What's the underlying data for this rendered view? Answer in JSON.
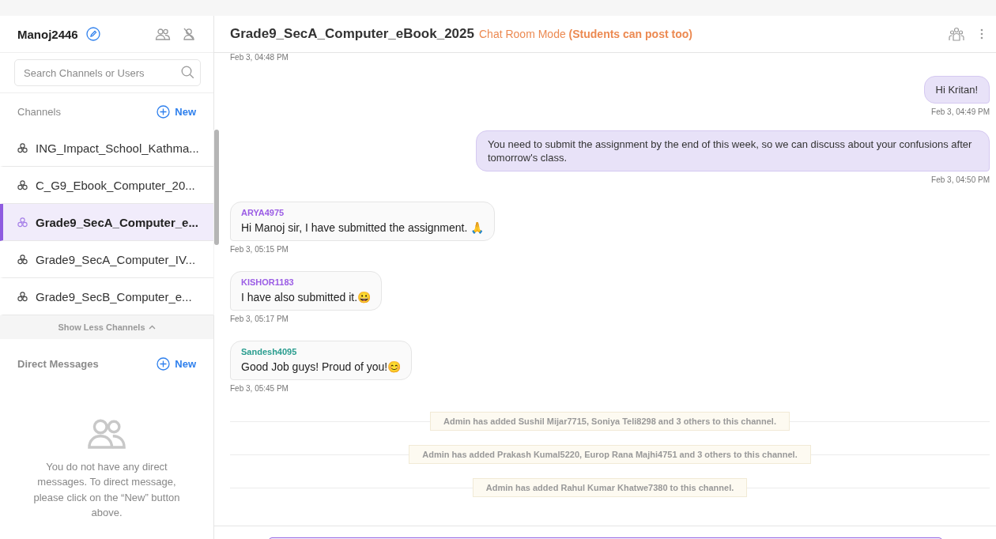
{
  "sidebar": {
    "username": "Manoj2446",
    "search": {
      "placeholder": "Search Channels or Users"
    },
    "channels_header": {
      "title": "Channels",
      "new_label": "New"
    },
    "channels": [
      {
        "name": "ING_Impact_School_Kathma...",
        "selected": false
      },
      {
        "name": "C_G9_Ebook_Computer_20...",
        "selected": false
      },
      {
        "name": "Grade9_SecA_Computer_e...",
        "selected": true
      },
      {
        "name": "Grade9_SecA_Computer_IV...",
        "selected": false
      },
      {
        "name": "Grade9_SecB_Computer_e...",
        "selected": false
      }
    ],
    "show_less": "Show Less Channels",
    "dm_header": {
      "title": "Direct Messages",
      "new_label": "New"
    },
    "dm_empty": "You do not have any direct messages. To direct message, please click on the “New” button above."
  },
  "chat": {
    "title": "Grade9_SecA_Computer_eBook_2025",
    "mode": "Chat Room Mode",
    "mode_note": "(Students can post too)",
    "messages": [
      {
        "kind": "timestamp",
        "time": "Feb 3, 04:48 PM"
      },
      {
        "kind": "outgoing",
        "text": "Hi Kritan!",
        "time": "Feb 3, 04:49 PM"
      },
      {
        "kind": "outgoing",
        "text": "You need to submit the assignment by the end of this week, so we can discuss about your confusions after tomorrow's class.",
        "time": "Feb 3, 04:50 PM"
      },
      {
        "kind": "incoming",
        "author": "ARYA4975",
        "color": "#9b5de5",
        "text": "Hi Manoj sir, I have submitted the assignment. 🙏",
        "time": "Feb 3, 05:15 PM"
      },
      {
        "kind": "incoming",
        "author": "KISHOR1183",
        "color": "#9b5de5",
        "text": "I have also submitted it.😀",
        "time": "Feb 3, 05:17 PM"
      },
      {
        "kind": "incoming",
        "author": "Sandesh4095",
        "color": "#2a9d8f",
        "text": "Good Job guys! Proud of you!😊",
        "time": "Feb 3, 05:45 PM"
      },
      {
        "kind": "system",
        "text": "Admin has added Sushil Mijar7715, Soniya Teli8298 and 3 others to this channel."
      },
      {
        "kind": "system",
        "text": "Admin has added Prakash Kumal5220, Europ Rana Majhi4751 and 3 others to this channel."
      },
      {
        "kind": "system",
        "text": "Admin has added Rahul Kumar Khatwe7380 to this channel."
      }
    ]
  }
}
